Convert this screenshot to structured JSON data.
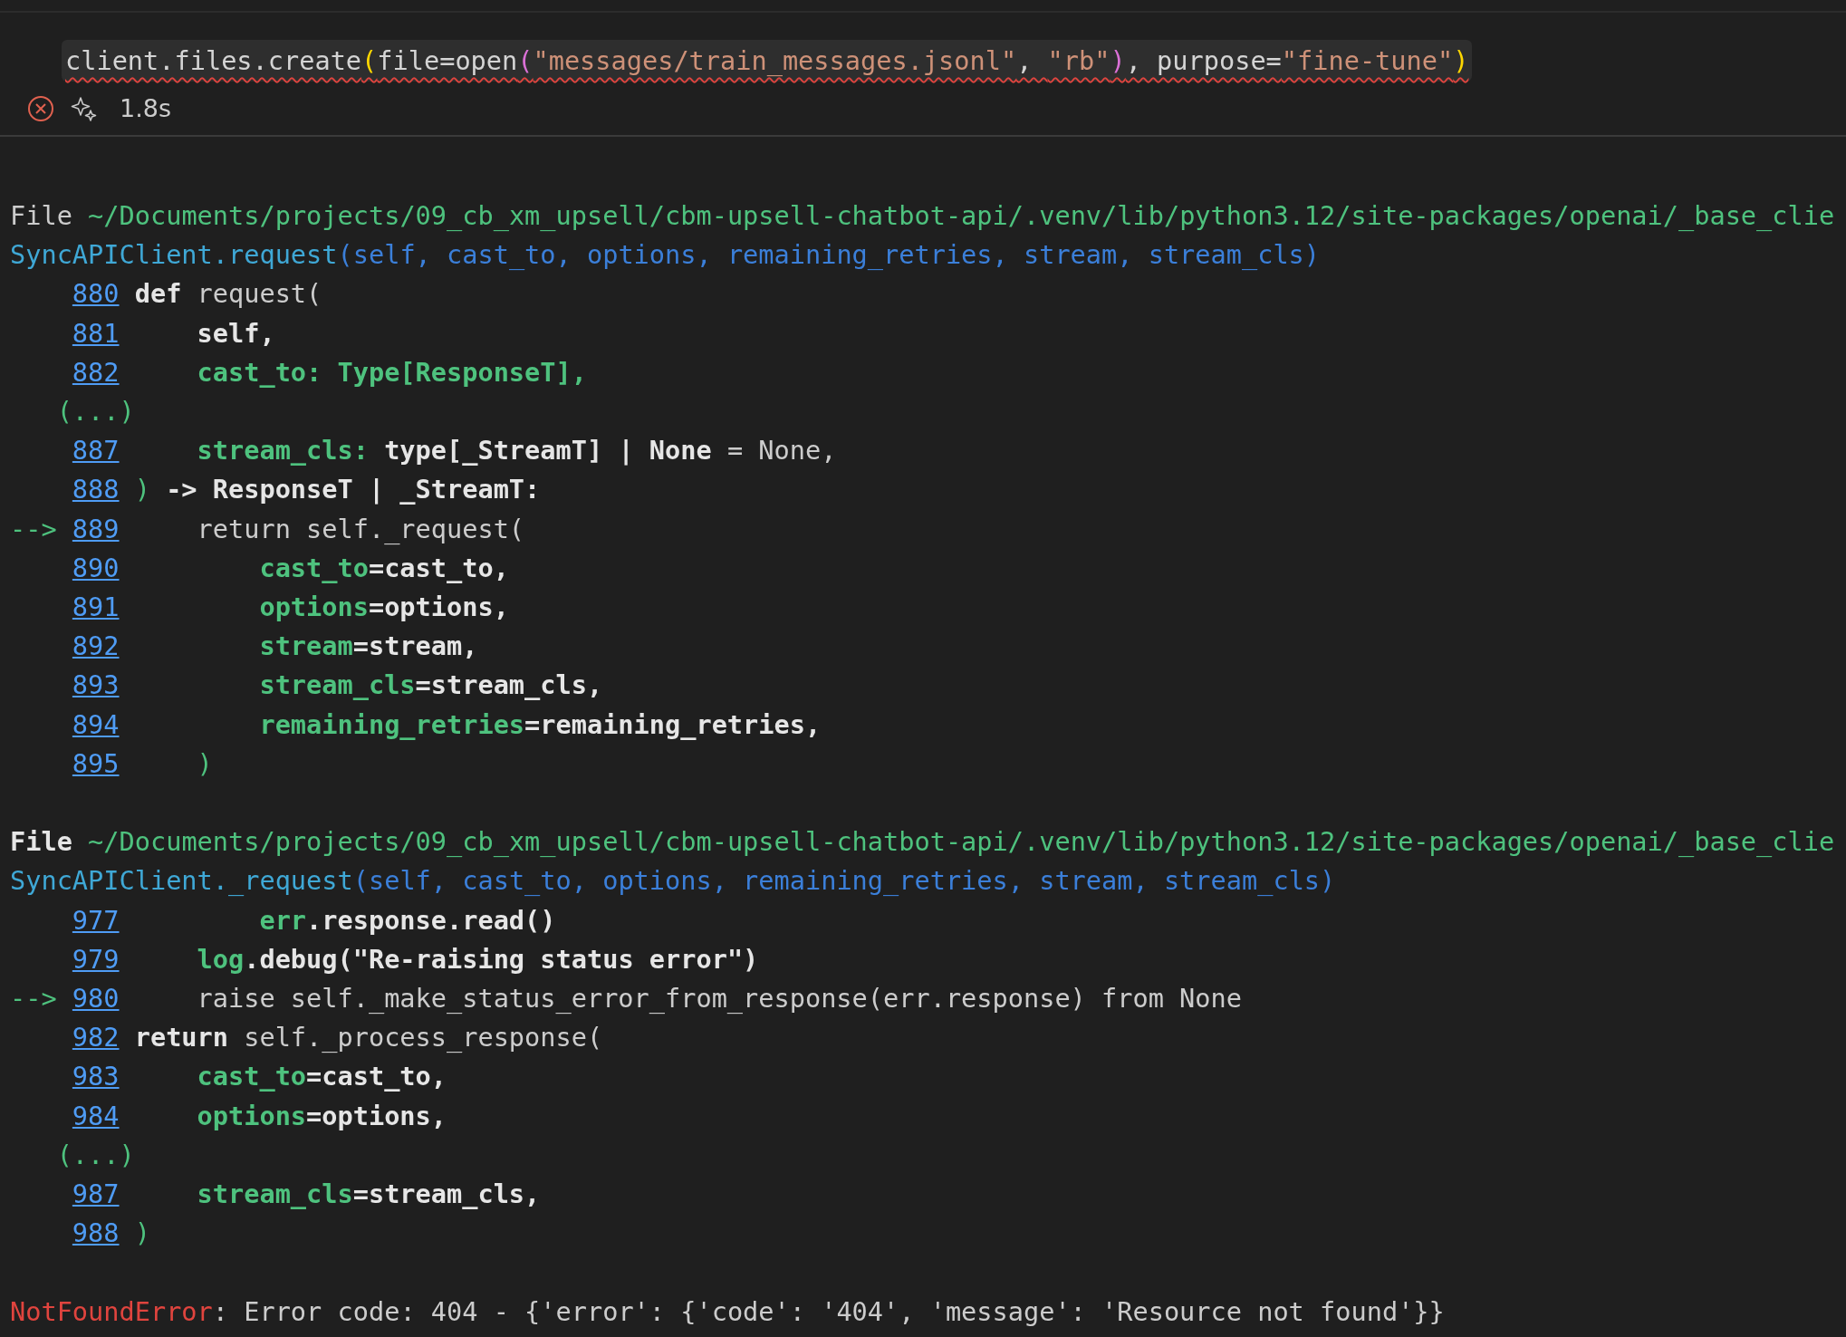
{
  "cell": {
    "failed": true,
    "has_error_squiggle": true,
    "code": [
      {
        "kind": "ident",
        "text": "client.files.create"
      },
      {
        "kind": "bracket1",
        "text": "("
      },
      {
        "kind": "ident",
        "text": "file=open"
      },
      {
        "kind": "bracket2",
        "text": "("
      },
      {
        "kind": "string",
        "text": "\"messages/train_messages.jsonl\""
      },
      {
        "kind": "ident",
        "text": ", "
      },
      {
        "kind": "string",
        "text": "\"rb\""
      },
      {
        "kind": "bracket2",
        "text": ")"
      },
      {
        "kind": "ident",
        "text": ", purpose="
      },
      {
        "kind": "string",
        "text": "\"fine-tune\""
      },
      {
        "kind": "bracket1",
        "text": ")"
      }
    ],
    "duration": "1.8s"
  },
  "traceback": [
    {
      "file": [
        {
          "kind": "plain",
          "text": "File"
        },
        {
          "kind": "path",
          "text": " ~/Documents/projects/09_cb_xm_upsell/cbm-upsell-chatbot-api/.venv/lib/python3.12/site-packages/openai/_base_clie"
        }
      ],
      "signature": [
        {
          "kind": "func",
          "text": "SyncAPIClient.request"
        },
        {
          "kind": "args",
          "text": "(self, cast_to, options, remaining_retries, stream, stream_cls)"
        }
      ],
      "lines": [
        {
          "kind": "code",
          "number": "880",
          "segments": [
            {
              "kind": "bold",
              "text": "def"
            },
            {
              "kind": "plain",
              "text": " request("
            }
          ]
        },
        {
          "kind": "code",
          "number": "881",
          "segments": [
            {
              "kind": "bold",
              "text": "    self,"
            }
          ]
        },
        {
          "kind": "code",
          "number": "882",
          "segments": [
            {
              "kind": "key",
              "text": "    cast_to: Type[ResponseT],"
            }
          ]
        },
        {
          "kind": "ellipsis",
          "text": "(...)"
        },
        {
          "kind": "code",
          "number": "887",
          "segments": [
            {
              "kind": "key",
              "text": "    stream_cls:"
            },
            {
              "kind": "bold",
              "text": " type[_StreamT] | None"
            },
            {
              "kind": "plain",
              "text": " = None,"
            }
          ]
        },
        {
          "kind": "code",
          "number": "888",
          "segments": [
            {
              "kind": "punct",
              "text": ")"
            },
            {
              "kind": "bold",
              "text": " -> ResponseT | _StreamT:"
            }
          ]
        },
        {
          "kind": "code",
          "number": "889",
          "marker": "-->",
          "segments": [
            {
              "kind": "plain",
              "text": "    return self._request("
            }
          ]
        },
        {
          "kind": "code",
          "number": "890",
          "segments": [
            {
              "kind": "key",
              "text": "        cast_to"
            },
            {
              "kind": "bold",
              "text": "=cast_to,"
            }
          ]
        },
        {
          "kind": "code",
          "number": "891",
          "segments": [
            {
              "kind": "key",
              "text": "        options"
            },
            {
              "kind": "bold",
              "text": "=options,"
            }
          ]
        },
        {
          "kind": "code",
          "number": "892",
          "segments": [
            {
              "kind": "key",
              "text": "        stream"
            },
            {
              "kind": "bold",
              "text": "=stream,"
            }
          ]
        },
        {
          "kind": "code",
          "number": "893",
          "segments": [
            {
              "kind": "key",
              "text": "        stream_cls"
            },
            {
              "kind": "bold",
              "text": "=stream_cls,"
            }
          ]
        },
        {
          "kind": "code",
          "number": "894",
          "segments": [
            {
              "kind": "key",
              "text": "        remaining_retries"
            },
            {
              "kind": "bold",
              "text": "=remaining_retries,"
            }
          ]
        },
        {
          "kind": "code",
          "number": "895",
          "segments": [
            {
              "kind": "punct",
              "text": "    )"
            }
          ]
        }
      ]
    },
    {
      "file": [
        {
          "kind": "bold",
          "text": "File"
        },
        {
          "kind": "path",
          "text": " ~/Documents/projects/09_cb_xm_upsell/cbm-upsell-chatbot-api/.venv/lib/python3.12/site-packages/openai/_base_clie"
        }
      ],
      "signature": [
        {
          "kind": "func",
          "text": "SyncAPIClient._request"
        },
        {
          "kind": "args",
          "text": "(self, cast_to, options, remaining_retries, stream, stream_cls)"
        }
      ],
      "lines": [
        {
          "kind": "code",
          "number": "977",
          "segments": [
            {
              "kind": "key",
              "text": "        err"
            },
            {
              "kind": "bold",
              "text": ".response.read()"
            }
          ]
        },
        {
          "kind": "code",
          "number": "979",
          "segments": [
            {
              "kind": "key",
              "text": "    log"
            },
            {
              "kind": "bold",
              "text": ".debug(\"Re-raising status error\")"
            }
          ]
        },
        {
          "kind": "code",
          "number": "980",
          "marker": "-->",
          "segments": [
            {
              "kind": "plain",
              "text": "    raise self._make_status_error_from_response(err.response) from None"
            }
          ]
        },
        {
          "kind": "code",
          "number": "982",
          "segments": [
            {
              "kind": "bold",
              "text": "return"
            },
            {
              "kind": "plain",
              "text": " self._process_response("
            }
          ]
        },
        {
          "kind": "code",
          "number": "983",
          "segments": [
            {
              "kind": "key",
              "text": "    cast_to"
            },
            {
              "kind": "bold",
              "text": "=cast_to,"
            }
          ]
        },
        {
          "kind": "code",
          "number": "984",
          "segments": [
            {
              "kind": "key",
              "text": "    options"
            },
            {
              "kind": "bold",
              "text": "=options,"
            }
          ]
        },
        {
          "kind": "ellipsis",
          "text": "(...)"
        },
        {
          "kind": "code",
          "number": "987",
          "segments": [
            {
              "kind": "key",
              "text": "    stream_cls"
            },
            {
              "kind": "bold",
              "text": "=stream_cls,"
            }
          ]
        },
        {
          "kind": "code",
          "number": "988",
          "segments": [
            {
              "kind": "punct",
              "text": ")"
            }
          ]
        }
      ]
    }
  ],
  "error": [
    {
      "kind": "error",
      "text": "NotFoundError"
    },
    {
      "kind": "plain",
      "text": ": Error code: 404 - {'error': {'code': '404', 'message': 'Resource not found'}}"
    }
  ]
}
